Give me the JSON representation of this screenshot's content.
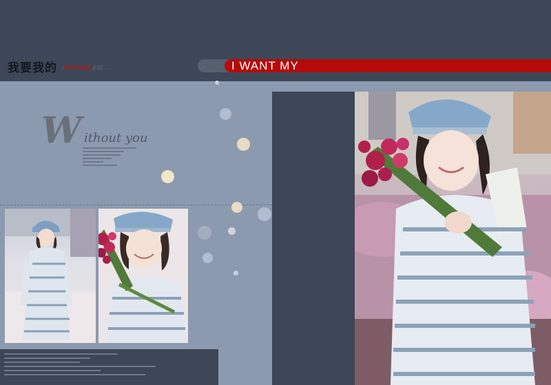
{
  "header": {
    "title_cn": "我要我的",
    "subtitle_prefix": "/",
    "subtitle_red": "FREEDOM",
    "subtitle_rest": "主题......",
    "banner_text": "I WANT MY"
  },
  "decor": {
    "script_initial": "W",
    "script_rest": "ithout you"
  },
  "colors": {
    "band": "#3d4757",
    "page": "#8c9ab0",
    "banner": "#b50b0b",
    "dark_panel": "#3c4657",
    "dot_cream": "#f2e6c8",
    "dot_blue": "#b3bdd0"
  },
  "photos": [
    {
      "name": "woman-standing-full-length"
    },
    {
      "name": "woman-with-flowers-closeup"
    },
    {
      "name": "woman-with-flowers-large"
    }
  ]
}
